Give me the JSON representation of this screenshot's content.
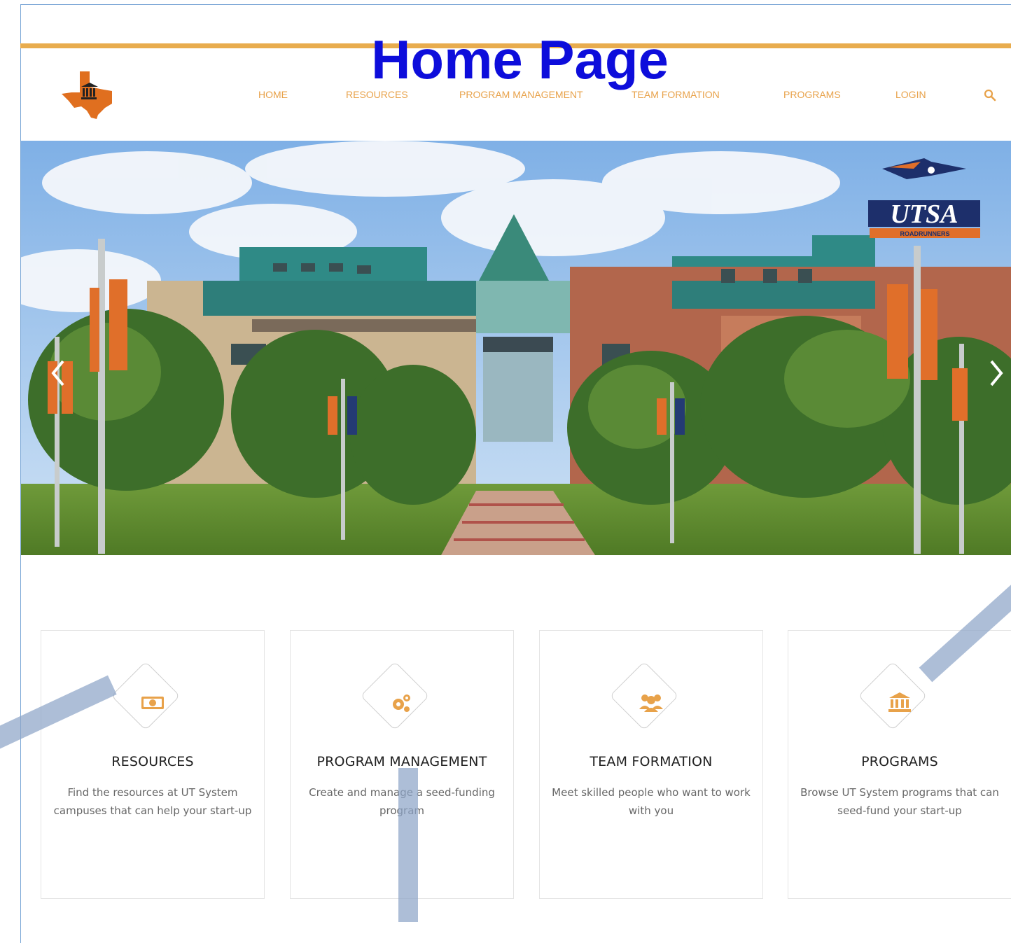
{
  "annotation": {
    "title": "Home Page"
  },
  "colors": {
    "accent": "#e8a24a",
    "annotation_title": "#0d0ddb",
    "overlay": "#8da5c8"
  },
  "header": {
    "logo_icon": "texas-institution-icon",
    "nav": [
      {
        "label": "HOME"
      },
      {
        "label": "RESOURCES"
      },
      {
        "label": "PROGRAM MANAGEMENT"
      },
      {
        "label": "TEAM FORMATION"
      },
      {
        "label": "PROGRAMS"
      },
      {
        "label": "LOGIN"
      }
    ],
    "search_icon": "search-icon"
  },
  "hero": {
    "image": "campus-building-photo",
    "logo_text": "UTSA",
    "logo_subtext": "ROADRUNNERS",
    "prev_icon": "chevron-left-icon",
    "next_icon": "chevron-right-icon"
  },
  "cards": [
    {
      "icon": "money-icon",
      "title": "RESOURCES",
      "desc": "Find the resources at UT System campuses that can help your start-up"
    },
    {
      "icon": "gears-icon",
      "title": "PROGRAM MANAGEMENT",
      "desc": "Create and manage a seed-funding program"
    },
    {
      "icon": "users-icon",
      "title": "TEAM FORMATION",
      "desc": "Meet skilled people who want to work with you"
    },
    {
      "icon": "institution-icon",
      "title": "PROGRAMS",
      "desc": "Browse UT System programs that can seed-fund your start-up"
    }
  ]
}
